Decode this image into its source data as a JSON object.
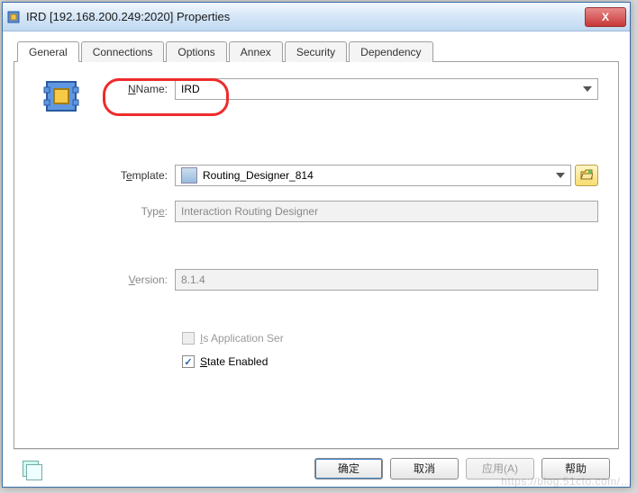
{
  "window": {
    "title": "IRD [192.168.200.249:2020] Properties",
    "close_glyph": "X"
  },
  "tabs": [
    {
      "label": "General"
    },
    {
      "label": "Connections"
    },
    {
      "label": "Options"
    },
    {
      "label": "Annex"
    },
    {
      "label": "Security"
    },
    {
      "label": "Dependency"
    }
  ],
  "form": {
    "name_label": "Name:",
    "name_value": "IRD",
    "template_label": "Template:",
    "template_value": "Routing_Designer_814",
    "type_label": "Type:",
    "type_value": "Interaction Routing Designer",
    "version_label": "Version:",
    "version_value": "8.1.4",
    "is_app_server_label": "Is Application Ser",
    "state_enabled_label": "State Enabled"
  },
  "buttons": {
    "ok": "确定",
    "cancel": "取消",
    "apply": "应用(A)",
    "help": "帮助"
  },
  "icons": {
    "app_icon": "application-component-icon",
    "open": "folder-open-icon",
    "copy": "copy-icon",
    "template_item": "component-icon"
  },
  "watermark": "https://blog.51cto.com/…"
}
